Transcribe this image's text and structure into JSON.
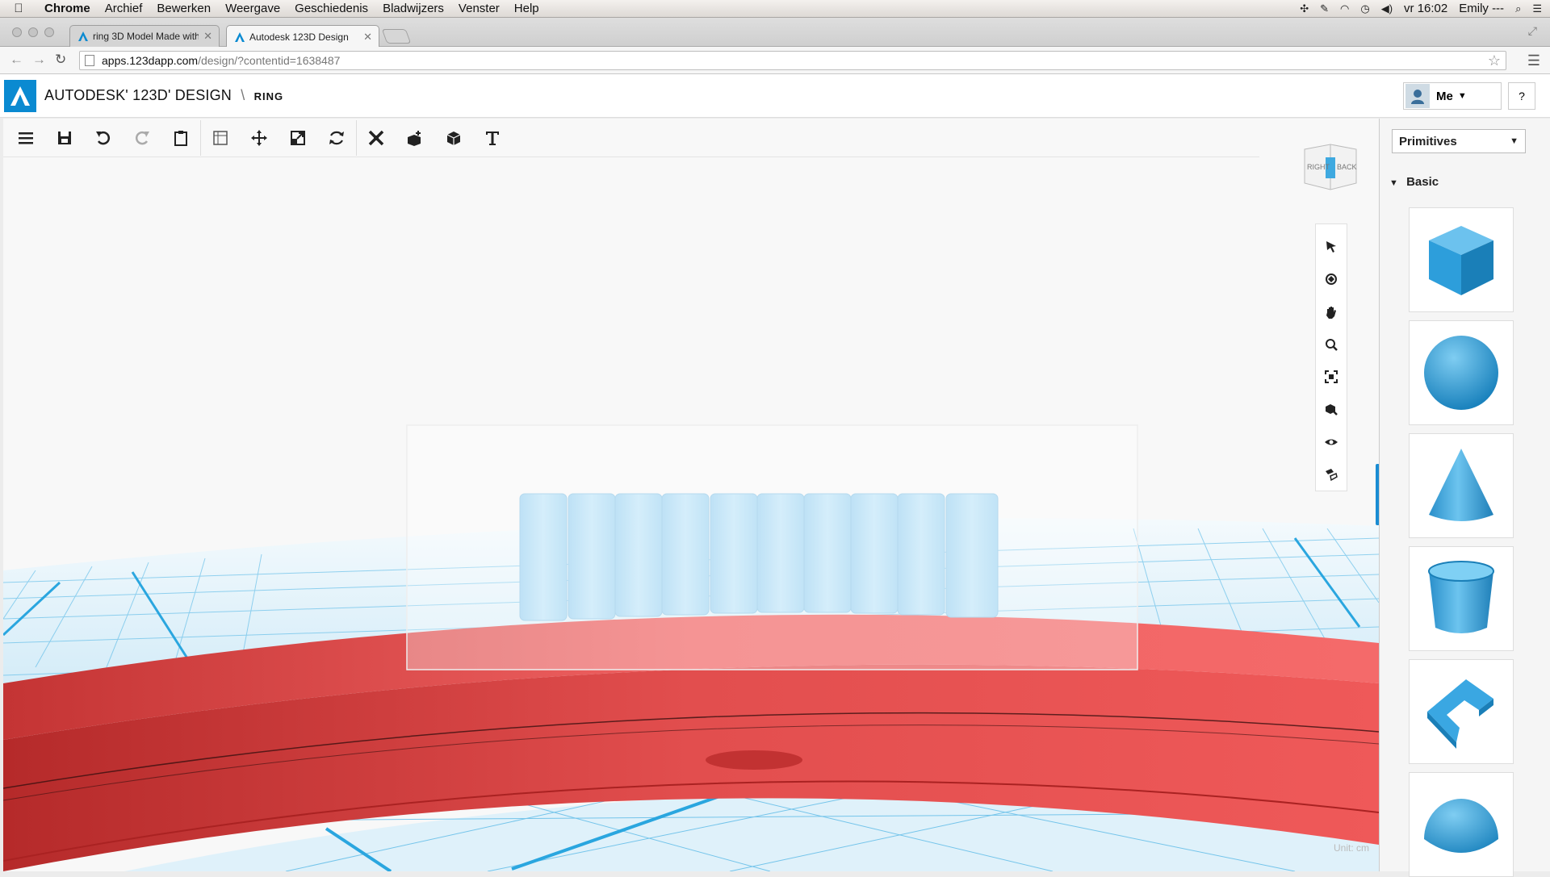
{
  "menubar": {
    "app": "Chrome",
    "items": [
      "Archief",
      "Bewerken",
      "Weergave",
      "Geschiedenis",
      "Bladwijzers",
      "Venster",
      "Help"
    ],
    "clock": "vr 16:02",
    "user": "Emily ---"
  },
  "tabs": [
    {
      "title": "ring 3D Model Made with",
      "active": false
    },
    {
      "title": "Autodesk 123D Design",
      "active": true
    }
  ],
  "address": {
    "host": "apps.123dapp.com",
    "path": "/design/?contentid=1638487"
  },
  "app": {
    "brand": "AUTODESK' 123D' DESIGN",
    "separator": "\\",
    "project": "RING",
    "user_label": "Me",
    "help": "?"
  },
  "toolbar_icons": [
    "menu-icon",
    "save-icon",
    "undo-icon",
    "redo-icon",
    "clipboard-icon",
    "grid-snap-icon",
    "move-icon",
    "scale-icon",
    "refresh-icon",
    "modify-icon",
    "combine-icon",
    "group-icon",
    "text-icon"
  ],
  "viewcube": {
    "left": "RIGHT",
    "right": "BACK"
  },
  "nav_icons": [
    "select-icon",
    "orbit-icon",
    "pan-icon",
    "zoom-icon",
    "fit-icon",
    "material-icon",
    "visibility-icon",
    "snap-icon"
  ],
  "unit_label": "Unit: cm",
  "panel": {
    "dropdown": "Primitives",
    "section": "Basic",
    "shapes": [
      "box",
      "sphere",
      "cone",
      "cylinder",
      "polygon-wedge",
      "hemisphere"
    ]
  },
  "colors": {
    "accent": "#0a8ad1",
    "ring": "#e84c4c",
    "cylinders": "#aedcf5",
    "grid": "#2aa6df"
  }
}
